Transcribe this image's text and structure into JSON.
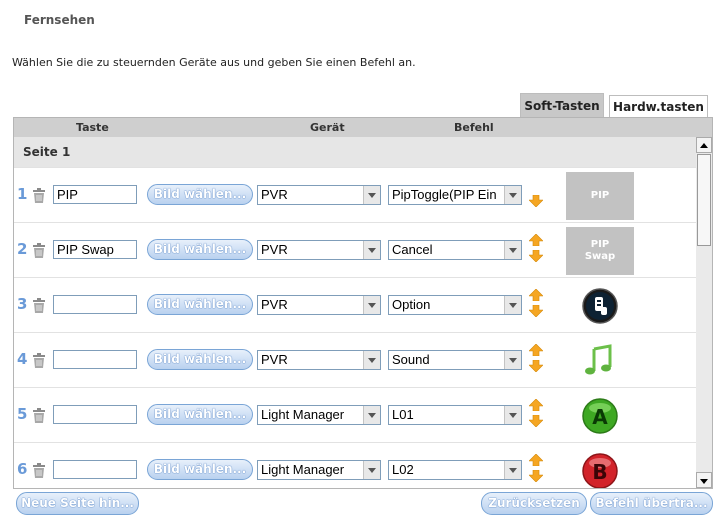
{
  "header": {
    "title": "Fernsehen",
    "intro": "Wählen Sie die zu steuernden Geräte aus und geben Sie einen Befehl an."
  },
  "tabs": [
    {
      "label": "Soft-Tasten",
      "active": true
    },
    {
      "label": "Hardw.tasten",
      "active": false
    }
  ],
  "columns": {
    "taste": "Taste",
    "geraet": "Gerät",
    "befehl": "Befehl"
  },
  "section": {
    "title": "Seite 1"
  },
  "rows": [
    {
      "num": "1",
      "taste": "PIP",
      "bild_label": "Bild wählen...",
      "geraet": "PVR",
      "befehl": "PipToggle(PIP Ein",
      "image": {
        "type": "text",
        "label": "PIP"
      },
      "show_up": false,
      "show_down": true
    },
    {
      "num": "2",
      "taste": "PIP Swap",
      "bild_label": "Bild wählen...",
      "geraet": "PVR",
      "befehl": "Cancel",
      "image": {
        "type": "text",
        "label": "PIP\nSwap"
      },
      "show_up": true,
      "show_down": true
    },
    {
      "num": "3",
      "taste": "",
      "bild_label": "Bild wählen...",
      "geraet": "PVR",
      "befehl": "Option",
      "image": {
        "type": "icon",
        "icon": "remote-control-icon"
      },
      "show_up": true,
      "show_down": true
    },
    {
      "num": "4",
      "taste": "",
      "bild_label": "Bild wählen...",
      "geraet": "PVR",
      "befehl": "Sound",
      "image": {
        "type": "icon",
        "icon": "music-note-icon"
      },
      "show_up": true,
      "show_down": true
    },
    {
      "num": "5",
      "taste": "",
      "bild_label": "Bild wählen...",
      "geraet": "Light Manager",
      "befehl": "L01",
      "image": {
        "type": "icon",
        "icon": "green-a-button-icon"
      },
      "show_up": true,
      "show_down": true
    },
    {
      "num": "6",
      "taste": "",
      "bild_label": "Bild wählen...",
      "geraet": "Light Manager",
      "befehl": "L02",
      "image": {
        "type": "icon",
        "icon": "red-b-button-icon"
      },
      "show_up": true,
      "show_down": true
    }
  ],
  "footer": {
    "neue_seite": "Neue Seite hin...",
    "zuruecksetzen": "Zurücksetzen",
    "befehl_uebertragen": "Befehl übertra..."
  },
  "colors": {
    "accent_blue": "#6a9ad8",
    "arrow_orange": "#f5a623",
    "image_bg": "#c2c2c2"
  }
}
